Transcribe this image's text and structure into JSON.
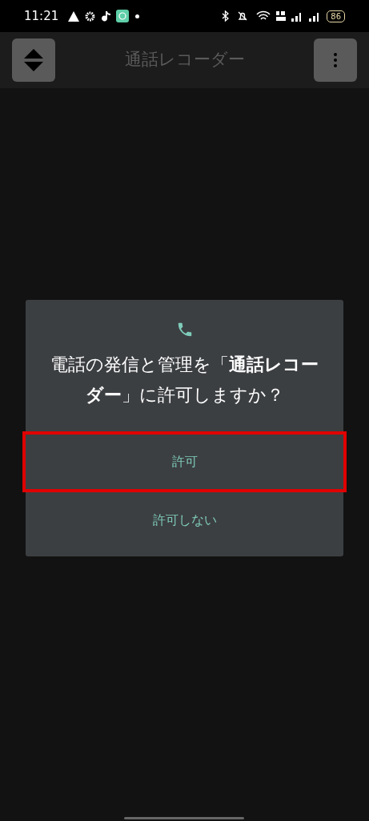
{
  "status_bar": {
    "time": "11:21",
    "battery": "86"
  },
  "app_bar": {
    "title": "通話レコーダー"
  },
  "dialog": {
    "message": "電話の発信と管理を「**通話レコーダー**」に許可しますか？",
    "buttons": [
      {
        "label": "許可",
        "highlighted": true
      },
      {
        "label": "許可しない",
        "highlighted": false
      }
    ]
  }
}
